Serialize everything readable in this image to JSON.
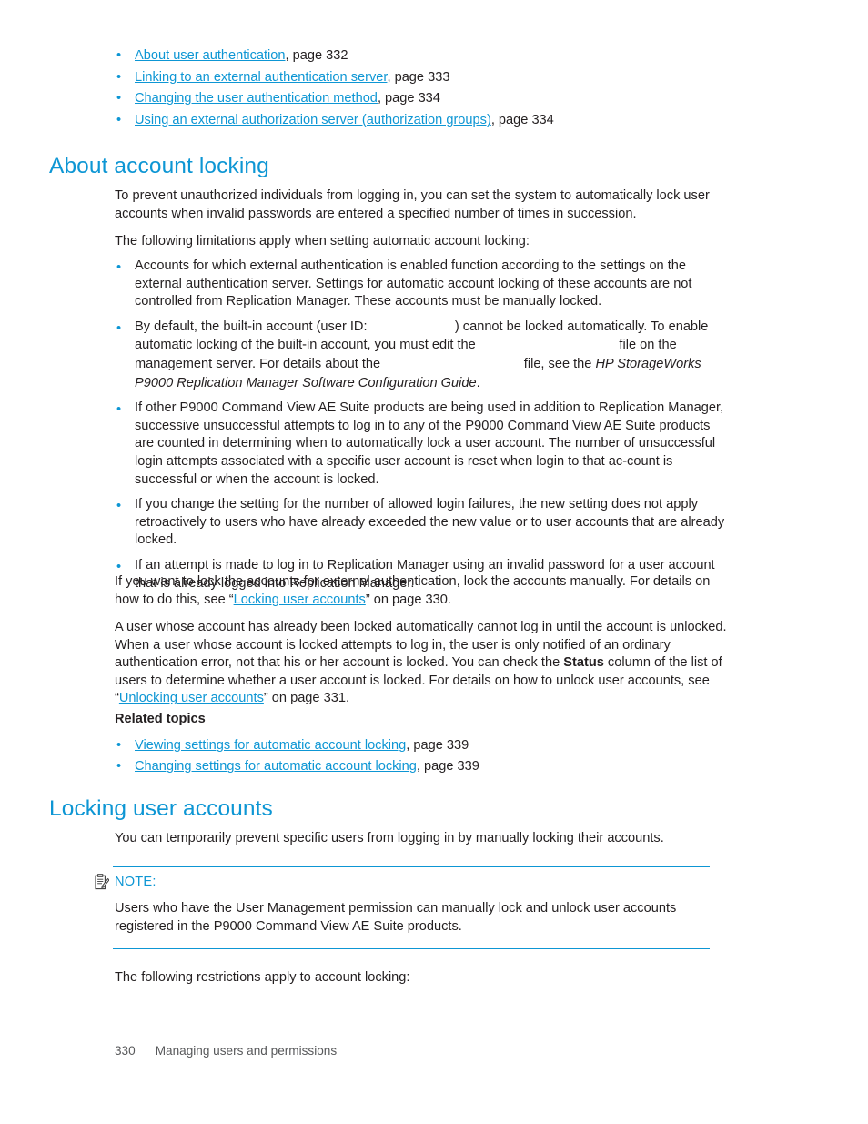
{
  "colors": {
    "accent_blue": "#0d96d4",
    "body_text": "#231f20",
    "footer_text": "#58595b"
  },
  "top_links": [
    {
      "bullet": "•",
      "link": "About user authentication",
      "tail": ", page 332"
    },
    {
      "bullet": "•",
      "link": "Linking to an external authentication server",
      "tail": ", page 333"
    },
    {
      "bullet": "•",
      "link": "Changing the user authentication method",
      "tail": ", page 334"
    },
    {
      "bullet": "•",
      "link": "Using an external authorization server (authorization groups)",
      "tail": ", page 334"
    }
  ],
  "section_about": {
    "heading": "About account locking",
    "intro": "To prevent unauthorized individuals from logging in, you can set the system to automatically lock user accounts when invalid passwords are entered a specified number of times in succession.",
    "limitations_lead": "The following limitations apply when setting automatic account locking:",
    "bullets": [
      {
        "bullet": "•",
        "text": "Accounts for which external authentication is enabled function according to the settings on the external authentication server. Settings for automatic account locking of these accounts are not controlled from Replication Manager. These accounts must be manually locked."
      },
      {
        "bullet": "•",
        "part1": "By default, the built-in account (user ID:",
        "gap1": "           ",
        "part2": ") cannot be locked automatically. To enable automatic locking of the built-in account, you must edit the",
        "gap2": "                  ",
        "part3": "file on the management server. For details about the",
        "gap3": "                  ",
        "part4": "file, see the",
        "guide_title": "HP StorageWorks P9000 Replication Manager Software Configuration Guide",
        "part5": "."
      },
      {
        "bullet": "•",
        "text": "If other P9000 Command View AE Suite products are being used in addition to Replication Manager, successive unsuccessful attempts to log in to any of the P9000 Command View AE Suite products are counted in determining when to automatically lock a user account. The number of unsuccessful login attempts associated with a specific user account is reset when login to that ac-count is successful or when the account is locked."
      },
      {
        "bullet": "•",
        "text": "If you change the setting for the number of allowed login failures, the new setting does not apply retroactively to users who have already exceeded the new value or to user accounts that are already locked."
      },
      {
        "bullet": "•",
        "text": "If an attempt is made to log in to Replication Manager using an invalid password for a user account that is already logged into Replication Manager."
      }
    ],
    "para_manual_lock": {
      "part1": "If you want to lock the accounts for external authentication, lock the accounts manually. For details on how to do this, see “",
      "link": "Locking user accounts",
      "part2": "” on page 330."
    },
    "para_locked_account": {
      "part1": "A user whose account has already been locked automatically cannot log in until the account is unlocked. When a user whose account is locked attempts to log in, the user is only notified of an ordinary authentication error, not that his or her account is locked.  You can check the ",
      "bold": "Status",
      "part2": " column of the list of users to determine whether a user account is locked. For details on how to unlock user accounts, see “",
      "link": "Unlocking user accounts",
      "part3": "” on page 331."
    },
    "related_topics_heading": "Related topics",
    "related_topics": [
      {
        "bullet": "•",
        "link": "Viewing settings for automatic account locking",
        "tail": ", page 339"
      },
      {
        "bullet": "•",
        "link": "Changing settings for automatic account locking",
        "tail": ", page 339"
      }
    ]
  },
  "section_locking": {
    "heading": "Locking user accounts",
    "intro": "You can temporarily prevent specific users from logging in by manually locking their accounts.",
    "note": {
      "label": "NOTE:",
      "icon": "note-clipboard-icon",
      "body": "Users who have the User Management permission can manually lock and unlock user accounts registered in the P9000 Command View AE Suite products."
    },
    "restrictions_lead": "The following restrictions apply to account locking:"
  },
  "footer": {
    "page_number": "330",
    "chapter": "Managing users and permissions"
  }
}
